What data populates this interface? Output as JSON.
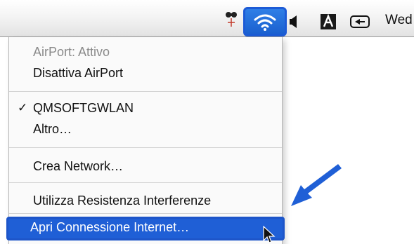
{
  "menubar": {
    "icons": [
      "menu-extra-icon",
      "airport-wifi-icon",
      "volume-icon",
      "input-menu-icon",
      "display-icon"
    ],
    "clock_text": "Wed"
  },
  "airport_menu": {
    "items": [
      {
        "label": "AirPort: Attivo",
        "enabled": false
      },
      {
        "label": "Disattiva AirPort",
        "enabled": true
      },
      {
        "label": "QMSOFTGWLAN",
        "enabled": true,
        "checked": true,
        "check_glyph": "✓"
      },
      {
        "label": "Altro…",
        "enabled": true
      },
      {
        "label": "Crea Network…",
        "enabled": true
      },
      {
        "label": "Utilizza Resistenza Interferenze",
        "enabled": true
      },
      {
        "label": "Apri Connessione Internet…",
        "enabled": true,
        "highlighted": true
      }
    ]
  },
  "colors": {
    "highlight": "#1f5fd6",
    "pointer_arrow": "#1f5fd6",
    "menu_background": "#fafafa"
  }
}
